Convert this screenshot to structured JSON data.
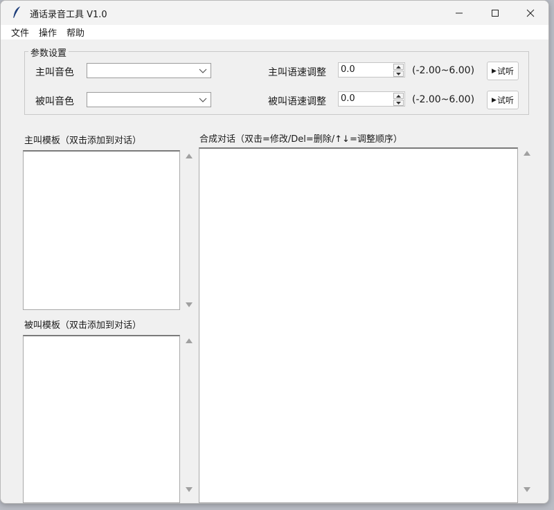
{
  "window": {
    "title": "通话录音工具 V1.0"
  },
  "menu": {
    "items": [
      "文件",
      "操作",
      "帮助"
    ]
  },
  "params": {
    "group_title": "参数设置",
    "caller_voice_label": "主叫音色",
    "callee_voice_label": "被叫音色",
    "caller_voice_value": "",
    "callee_voice_value": "",
    "caller_speed_label": "主叫语速调整",
    "callee_speed_label": "被叫语速调整",
    "caller_speed_value": "0.0",
    "callee_speed_value": "0.0",
    "speed_range": "(-2.00~6.00)",
    "preview_label": "试听",
    "preview_glyph": "▶"
  },
  "caller_templates": {
    "label": "主叫模板（双击添加到对话）"
  },
  "callee_templates": {
    "label": "被叫模板（双击添加到对话）"
  },
  "dialog": {
    "label": "合成对话（双击=修改/Del=删除/↑↓=调整顺序）"
  },
  "colors": {
    "window_bg": "#f0f0f0",
    "list_bg": "#ffffff",
    "accent_icon": "#1f3f7a"
  },
  "icons": {
    "app": "feather-icon",
    "minimize": "minimize-icon",
    "maximize": "maximize-icon",
    "close": "close-icon"
  }
}
